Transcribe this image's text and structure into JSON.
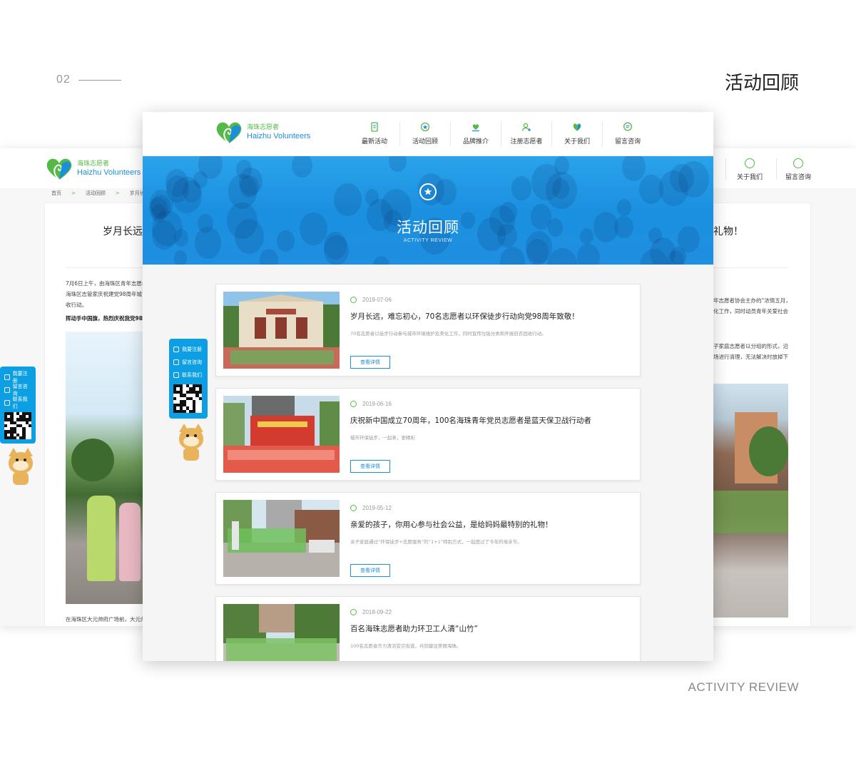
{
  "board": {
    "section_number": "02",
    "section_title": "活动回顾",
    "section_subtitle": "ACTIVITY REVIEW"
  },
  "logo": {
    "cn": "海珠志愿者",
    "en": "Haizhu Volunteers"
  },
  "nav": {
    "items": [
      {
        "label": "最新活动",
        "icon": "document-icon"
      },
      {
        "label": "活动回顾",
        "icon": "refresh-star-icon"
      },
      {
        "label": "品牌推介",
        "icon": "heart-hands-icon"
      },
      {
        "label": "注册志愿者",
        "icon": "add-user-icon"
      },
      {
        "label": "关于我们",
        "icon": "heart-logo-icon"
      },
      {
        "label": "留言咨询",
        "icon": "chat-icon"
      }
    ]
  },
  "banner": {
    "title": "活动回顾",
    "subtitle": "ACTIVITY REVIEW"
  },
  "side_widget": {
    "items": [
      {
        "label": "我要注册",
        "icon": "user-icon"
      },
      {
        "label": "留言咨询",
        "icon": "edit-icon"
      },
      {
        "label": "联系我们",
        "icon": "building-icon"
      }
    ]
  },
  "activities": [
    {
      "date": "2019-07-06",
      "title": "岁月长远，难忘初心，70名志愿者以环保徒步行动向党98周年致敬！",
      "desc": "70名志愿者以徒步行动参与城市环境维护及美化工作，同时宣传垃圾分类和开展旧衣回收行动。",
      "button": "查看详情"
    },
    {
      "date": "2019-06-16",
      "title": "庆祝新中国成立70周年，100名海珠青年党员志愿者是蓝天保卫战行动者",
      "desc": "城市环保徒步，一起来，更精彩",
      "button": "查看详情"
    },
    {
      "date": "2019-05-12",
      "title": "亲爱的孩子，你用心参与社会公益，是给妈妈最特别的礼物！",
      "desc": "亲子家庭通过“环保徒步+志愿服务”的“1+1”特别方式，一起度过了今年的母亲节。",
      "button": "查看详情"
    },
    {
      "date": "2018-09-22",
      "title": "百名海珠志愿者助力环卫工人清“山竹”",
      "desc": "100名志愿者齐力清洁受灾街道，共同建设美丽海珠。",
      "button": "查看详情"
    }
  ],
  "detail_page": {
    "breadcrumb": [
      "首页",
      "活动回顾",
      "岁月长远..."
    ],
    "title_left": "岁月长远，",
    "title_right": "礼物！",
    "para_left_1": "7月6日上午，由海珠区青年志愿者",
    "para_left_2": "海珠区志管家庆祝建党98周年城市",
    "para_left_3": "收行动。",
    "bold_line": "挥动手中国旗，热烈庆祝我党98",
    "para_right_1": "年志愿者协会主办的“浓情五月，",
    "para_right_2": "化工作，同时动员青年关爱社会",
    "para_right_3": "子家庭志愿者以分组的形式，沿",
    "para_right_4": "场进行清理，无法解决时放掉下",
    "caption": "在海珠区大元帅府广场前，大元帅",
    "nav_right": [
      "关于我们",
      "留言咨询"
    ]
  },
  "colors": {
    "brand_blue": "#1c8fd9",
    "brand_green": "#55b947",
    "banner_blue": "#1f95e4",
    "widget_blue": "#0d9fe3"
  }
}
